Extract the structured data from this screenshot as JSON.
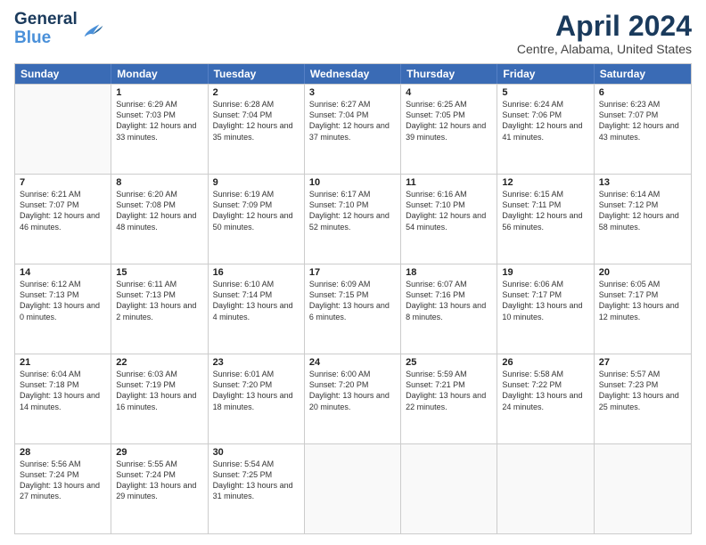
{
  "header": {
    "logo": {
      "line1": "General",
      "line2": "Blue"
    },
    "title": "April 2024",
    "subtitle": "Centre, Alabama, United States"
  },
  "weekdays": [
    "Sunday",
    "Monday",
    "Tuesday",
    "Wednesday",
    "Thursday",
    "Friday",
    "Saturday"
  ],
  "rows": [
    [
      {
        "day": "",
        "sunrise": "",
        "sunset": "",
        "daylight": ""
      },
      {
        "day": "1",
        "sunrise": "Sunrise: 6:29 AM",
        "sunset": "Sunset: 7:03 PM",
        "daylight": "Daylight: 12 hours and 33 minutes."
      },
      {
        "day": "2",
        "sunrise": "Sunrise: 6:28 AM",
        "sunset": "Sunset: 7:04 PM",
        "daylight": "Daylight: 12 hours and 35 minutes."
      },
      {
        "day": "3",
        "sunrise": "Sunrise: 6:27 AM",
        "sunset": "Sunset: 7:04 PM",
        "daylight": "Daylight: 12 hours and 37 minutes."
      },
      {
        "day": "4",
        "sunrise": "Sunrise: 6:25 AM",
        "sunset": "Sunset: 7:05 PM",
        "daylight": "Daylight: 12 hours and 39 minutes."
      },
      {
        "day": "5",
        "sunrise": "Sunrise: 6:24 AM",
        "sunset": "Sunset: 7:06 PM",
        "daylight": "Daylight: 12 hours and 41 minutes."
      },
      {
        "day": "6",
        "sunrise": "Sunrise: 6:23 AM",
        "sunset": "Sunset: 7:07 PM",
        "daylight": "Daylight: 12 hours and 43 minutes."
      }
    ],
    [
      {
        "day": "7",
        "sunrise": "Sunrise: 6:21 AM",
        "sunset": "Sunset: 7:07 PM",
        "daylight": "Daylight: 12 hours and 46 minutes."
      },
      {
        "day": "8",
        "sunrise": "Sunrise: 6:20 AM",
        "sunset": "Sunset: 7:08 PM",
        "daylight": "Daylight: 12 hours and 48 minutes."
      },
      {
        "day": "9",
        "sunrise": "Sunrise: 6:19 AM",
        "sunset": "Sunset: 7:09 PM",
        "daylight": "Daylight: 12 hours and 50 minutes."
      },
      {
        "day": "10",
        "sunrise": "Sunrise: 6:17 AM",
        "sunset": "Sunset: 7:10 PM",
        "daylight": "Daylight: 12 hours and 52 minutes."
      },
      {
        "day": "11",
        "sunrise": "Sunrise: 6:16 AM",
        "sunset": "Sunset: 7:10 PM",
        "daylight": "Daylight: 12 hours and 54 minutes."
      },
      {
        "day": "12",
        "sunrise": "Sunrise: 6:15 AM",
        "sunset": "Sunset: 7:11 PM",
        "daylight": "Daylight: 12 hours and 56 minutes."
      },
      {
        "day": "13",
        "sunrise": "Sunrise: 6:14 AM",
        "sunset": "Sunset: 7:12 PM",
        "daylight": "Daylight: 12 hours and 58 minutes."
      }
    ],
    [
      {
        "day": "14",
        "sunrise": "Sunrise: 6:12 AM",
        "sunset": "Sunset: 7:13 PM",
        "daylight": "Daylight: 13 hours and 0 minutes."
      },
      {
        "day": "15",
        "sunrise": "Sunrise: 6:11 AM",
        "sunset": "Sunset: 7:13 PM",
        "daylight": "Daylight: 13 hours and 2 minutes."
      },
      {
        "day": "16",
        "sunrise": "Sunrise: 6:10 AM",
        "sunset": "Sunset: 7:14 PM",
        "daylight": "Daylight: 13 hours and 4 minutes."
      },
      {
        "day": "17",
        "sunrise": "Sunrise: 6:09 AM",
        "sunset": "Sunset: 7:15 PM",
        "daylight": "Daylight: 13 hours and 6 minutes."
      },
      {
        "day": "18",
        "sunrise": "Sunrise: 6:07 AM",
        "sunset": "Sunset: 7:16 PM",
        "daylight": "Daylight: 13 hours and 8 minutes."
      },
      {
        "day": "19",
        "sunrise": "Sunrise: 6:06 AM",
        "sunset": "Sunset: 7:17 PM",
        "daylight": "Daylight: 13 hours and 10 minutes."
      },
      {
        "day": "20",
        "sunrise": "Sunrise: 6:05 AM",
        "sunset": "Sunset: 7:17 PM",
        "daylight": "Daylight: 13 hours and 12 minutes."
      }
    ],
    [
      {
        "day": "21",
        "sunrise": "Sunrise: 6:04 AM",
        "sunset": "Sunset: 7:18 PM",
        "daylight": "Daylight: 13 hours and 14 minutes."
      },
      {
        "day": "22",
        "sunrise": "Sunrise: 6:03 AM",
        "sunset": "Sunset: 7:19 PM",
        "daylight": "Daylight: 13 hours and 16 minutes."
      },
      {
        "day": "23",
        "sunrise": "Sunrise: 6:01 AM",
        "sunset": "Sunset: 7:20 PM",
        "daylight": "Daylight: 13 hours and 18 minutes."
      },
      {
        "day": "24",
        "sunrise": "Sunrise: 6:00 AM",
        "sunset": "Sunset: 7:20 PM",
        "daylight": "Daylight: 13 hours and 20 minutes."
      },
      {
        "day": "25",
        "sunrise": "Sunrise: 5:59 AM",
        "sunset": "Sunset: 7:21 PM",
        "daylight": "Daylight: 13 hours and 22 minutes."
      },
      {
        "day": "26",
        "sunrise": "Sunrise: 5:58 AM",
        "sunset": "Sunset: 7:22 PM",
        "daylight": "Daylight: 13 hours and 24 minutes."
      },
      {
        "day": "27",
        "sunrise": "Sunrise: 5:57 AM",
        "sunset": "Sunset: 7:23 PM",
        "daylight": "Daylight: 13 hours and 25 minutes."
      }
    ],
    [
      {
        "day": "28",
        "sunrise": "Sunrise: 5:56 AM",
        "sunset": "Sunset: 7:24 PM",
        "daylight": "Daylight: 13 hours and 27 minutes."
      },
      {
        "day": "29",
        "sunrise": "Sunrise: 5:55 AM",
        "sunset": "Sunset: 7:24 PM",
        "daylight": "Daylight: 13 hours and 29 minutes."
      },
      {
        "day": "30",
        "sunrise": "Sunrise: 5:54 AM",
        "sunset": "Sunset: 7:25 PM",
        "daylight": "Daylight: 13 hours and 31 minutes."
      },
      {
        "day": "",
        "sunrise": "",
        "sunset": "",
        "daylight": ""
      },
      {
        "day": "",
        "sunrise": "",
        "sunset": "",
        "daylight": ""
      },
      {
        "day": "",
        "sunrise": "",
        "sunset": "",
        "daylight": ""
      },
      {
        "day": "",
        "sunrise": "",
        "sunset": "",
        "daylight": ""
      }
    ]
  ]
}
